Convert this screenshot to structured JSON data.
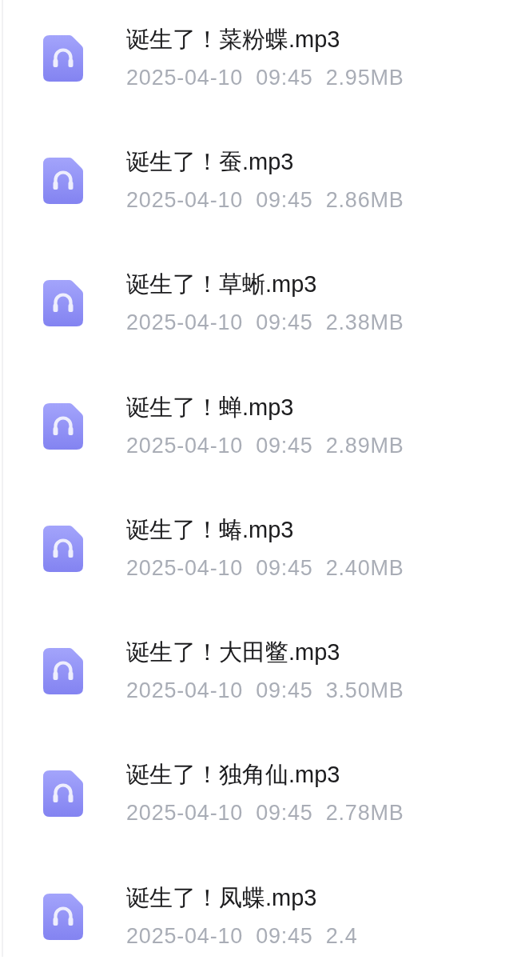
{
  "files": [
    {
      "name": "诞生了！菜粉蝶.mp3",
      "date": "2025-04-10",
      "time": "09:45",
      "size": "2.95MB"
    },
    {
      "name": "诞生了！蚕.mp3",
      "date": "2025-04-10",
      "time": "09:45",
      "size": "2.86MB"
    },
    {
      "name": "诞生了！草蜥.mp3",
      "date": "2025-04-10",
      "time": "09:45",
      "size": "2.38MB"
    },
    {
      "name": "诞生了！蝉.mp3",
      "date": "2025-04-10",
      "time": "09:45",
      "size": "2.89MB"
    },
    {
      "name": "诞生了！蝽.mp3",
      "date": "2025-04-10",
      "time": "09:45",
      "size": "2.40MB"
    },
    {
      "name": "诞生了！大田鳖.mp3",
      "date": "2025-04-10",
      "time": "09:45",
      "size": "3.50MB"
    },
    {
      "name": "诞生了！独角仙.mp3",
      "date": "2025-04-10",
      "time": "09:45",
      "size": "2.78MB"
    },
    {
      "name": "诞生了！凤蝶.mp3",
      "date": "2025-04-10",
      "time": "09:45",
      "size": "2.4"
    }
  ]
}
